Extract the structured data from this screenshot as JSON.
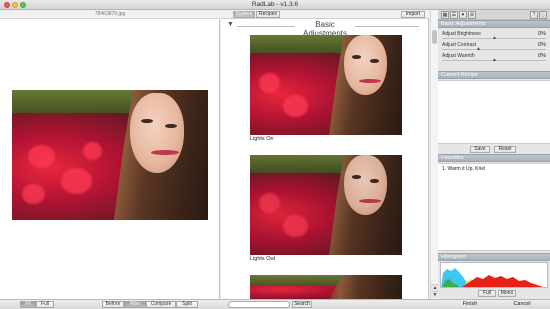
{
  "window": {
    "title": "RadLab - v1.3.6"
  },
  "preview": {
    "filename": "78463879.jpg"
  },
  "recipes": {
    "tabs": [
      "System",
      "Recipes"
    ],
    "active_tab": "System",
    "import_label": "Import",
    "group_title": "Basic Adjustments",
    "items": [
      {
        "label": "Lights On"
      },
      {
        "label": "Lights Out"
      }
    ]
  },
  "bottom_bar": {
    "zoom_buttons": [
      "Fit",
      "Full"
    ],
    "zoom_active": "Fit",
    "view_buttons": [
      "Before",
      "After",
      "Compare",
      "Split"
    ],
    "view_active": "After",
    "search_label": "Search"
  },
  "panel": {
    "icons": [
      "grid-icon",
      "list-icon",
      "heart-icon",
      "settings-icon",
      "help-icon",
      "info-icon"
    ],
    "basic_adjustments": {
      "header": "Basic Adjustments",
      "rows": [
        {
          "label": "Adjust Brightness",
          "value": "0%"
        },
        {
          "label": "Adjust Contrast",
          "value": "0%"
        },
        {
          "label": "Adjust Warmth",
          "value": "0%"
        }
      ]
    },
    "current_recipe": {
      "header": "Current Recipe",
      "save_label": "Save",
      "reset_label": "Reset"
    },
    "favorites": {
      "header": "Favorites",
      "items": [
        "1.  Warm it Up, Kriel"
      ]
    },
    "histogram": {
      "header": "Histogram",
      "modes": [
        "Full",
        "Mono"
      ],
      "active_mode": "Full",
      "colors": {
        "blue": "#3ec7f0",
        "red": "#e8201a",
        "yellow": "#f6e53a",
        "green": "#3ab04a"
      }
    },
    "actions": {
      "finish_label": "Finish",
      "cancel_label": "Cancel"
    }
  }
}
